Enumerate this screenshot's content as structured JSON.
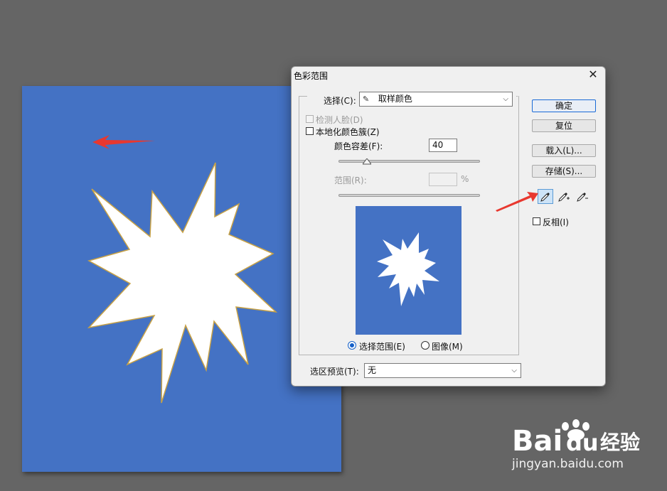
{
  "dialog": {
    "title": "色彩范围",
    "close_glyph": "✕",
    "select_label": "选择(C):",
    "select_value": "取样颜色",
    "detect_faces_label": "检测人脸(D)",
    "localized_clusters_label": "本地化颜色簇(Z)",
    "fuzziness_label": "颜色容差(F):",
    "fuzziness_value": "40",
    "range_label": "范围(R):",
    "range_value": "",
    "range_unit": "%",
    "radio_selection_label": "选择范围(E)",
    "radio_image_label": "图像(M)",
    "selection_preview_label": "选区预览(T):",
    "selection_preview_value": "无",
    "buttons": {
      "ok": "确定",
      "reset": "复位",
      "load": "载入(L)...",
      "save": "存储(S)..."
    },
    "invert_label": "反相(I)"
  },
  "state": {
    "fuzziness_slider_fraction": 0.2,
    "selected_radio": "selection",
    "active_eyedropper": "eyedropper"
  },
  "colors": {
    "canvas_blue": "#4472c4",
    "annotation_red": "#e8382f",
    "workspace": "#656565"
  },
  "watermark": {
    "logo_text": "Bai",
    "logo_text2": "du",
    "logo_cn": "经验",
    "url": "jingyan.baidu.com"
  }
}
